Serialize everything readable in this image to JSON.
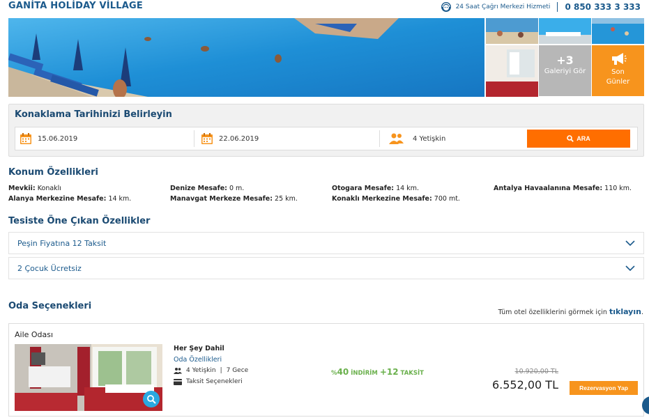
{
  "header": {
    "hotel_name": "GANİTA HOLİDAY VİLLAGE",
    "call_center_label": "24 Saat Çağrı Merkezi Hizmeti",
    "phone": "0 850 333 3 333"
  },
  "gallery": {
    "more_count": "+3",
    "more_label": "Galeriyi Gör",
    "last_days_line1": "Son",
    "last_days_line2": "Günler"
  },
  "booking": {
    "title": "Konaklama Tarihinizi Belirleyin",
    "checkin": "15.06.2019",
    "checkout": "22.06.2019",
    "guests": "4 Yetişkin",
    "search_label": "ARA"
  },
  "location": {
    "title": "Konum Özellikleri",
    "items": [
      {
        "label": "Mevkii:",
        "value": " Konaklı"
      },
      {
        "label": "Denize Mesafe:",
        "value": " 0 m."
      },
      {
        "label": "Otogara Mesafe:",
        "value": " 14 km."
      },
      {
        "label": "Antalya Havaalanına Mesafe:",
        "value": " 110 km."
      },
      {
        "label": "Alanya Merkezine Mesafe:",
        "value": " 14 km."
      },
      {
        "label": "Manavgat Merkeze Mesafe:",
        "value": " 25 km."
      },
      {
        "label": "Konaklı Merkezine Mesafe:",
        "value": " 700 mt."
      }
    ]
  },
  "highlights": {
    "title": "Tesiste Öne Çıkan Özellikler",
    "items": [
      {
        "label": "Peşin Fiyatına 12 Taksit"
      },
      {
        "label": "2 Çocuk Ücretsiz"
      }
    ]
  },
  "rooms": {
    "title": "Oda Seçenekleri",
    "all_features_text": "Tüm otel özelliklerini görmek için ",
    "all_features_link": "tıklayın",
    "all_features_end": ".",
    "room": {
      "name": "Aile Odası",
      "board": "Her Şey Dahil",
      "features_link": "Oda Özellikleri",
      "guests": "4 Yetişkin",
      "nights": "7 Gece",
      "installments": "Taksit Seçenekleri",
      "discount_prefix": "%",
      "discount_value": "40",
      "discount_text": " İNDİRİM ",
      "taksit_value": "+12",
      "taksit_text": " TAKSİT",
      "old_price": "10.920,00 TL",
      "price": "6.552,00 TL",
      "reserve_label": "Rezervasyon Yap"
    }
  },
  "colors": {
    "brand_blue": "#1b5a8c",
    "orange": "#f7941d",
    "search_orange": "#ff6e00",
    "discount_green": "#6ab04c"
  }
}
